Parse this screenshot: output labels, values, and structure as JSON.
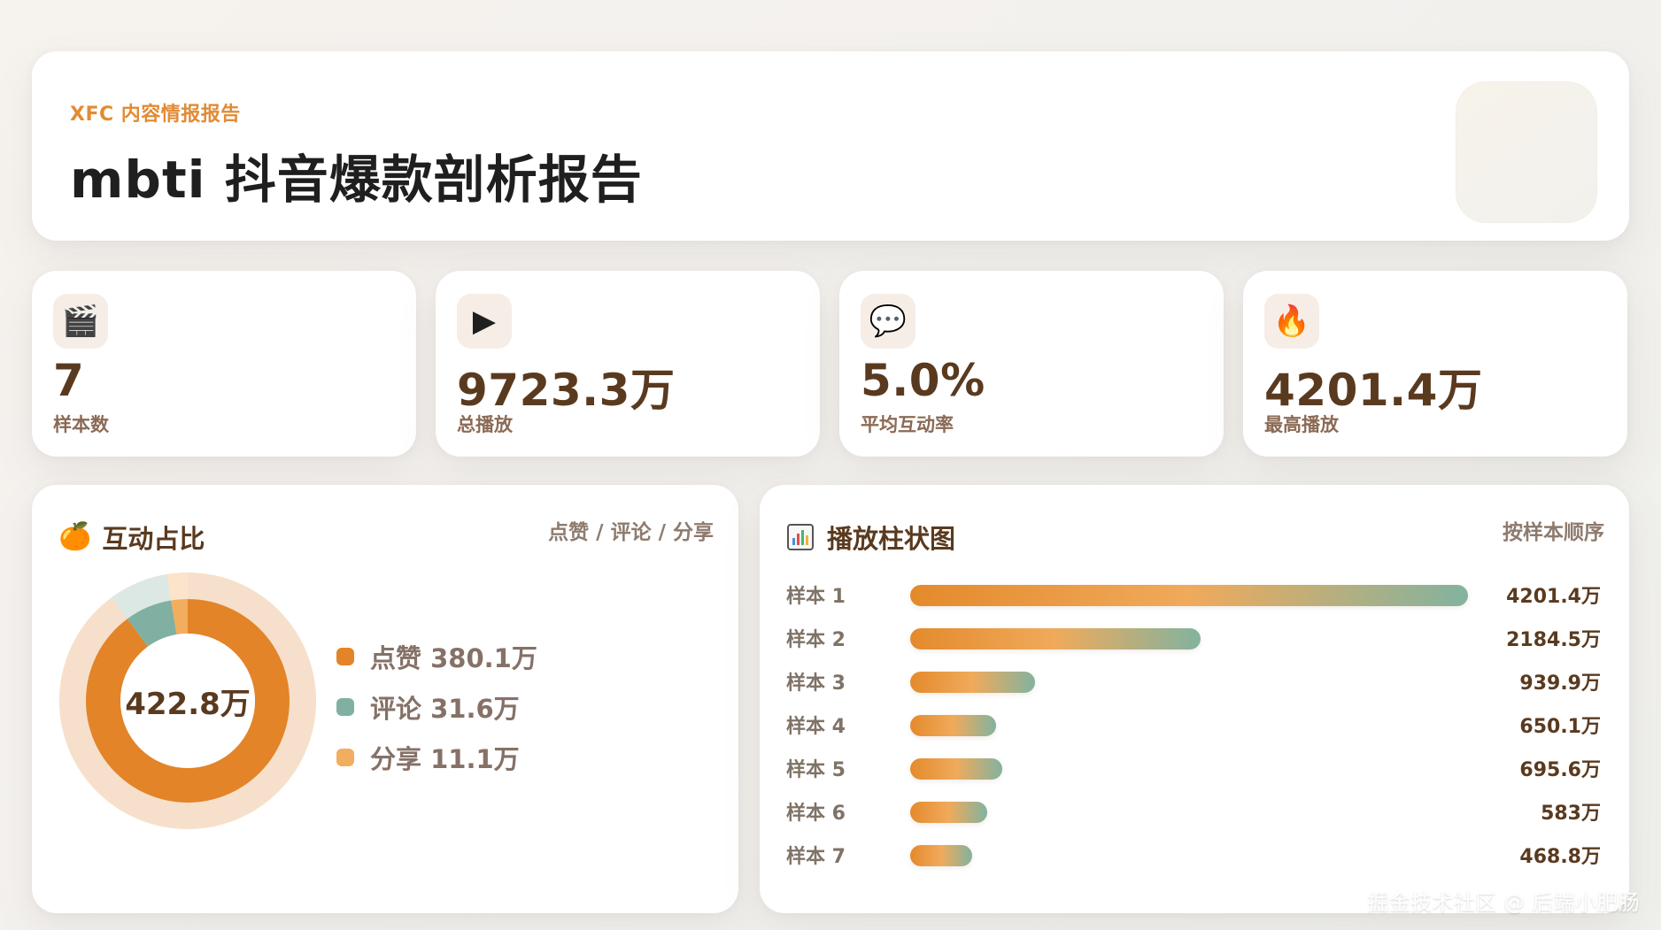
{
  "header": {
    "eyebrow": "XFC 内容情报报告",
    "title": "mbti 抖音爆款剖析报告"
  },
  "stats": [
    {
      "icon": "clapperboard-icon",
      "icon_glyph": "🎬",
      "value": "7",
      "label": "样本数"
    },
    {
      "icon": "play-icon",
      "icon_glyph": "▶",
      "value": "9723.3万",
      "label": "总播放"
    },
    {
      "icon": "chat-icon",
      "icon_glyph": "💬",
      "value": "5.0%",
      "label": "平均互动率"
    },
    {
      "icon": "fire-icon",
      "icon_glyph": "🔥",
      "value": "4201.4万",
      "label": "最高播放"
    }
  ],
  "interaction_panel": {
    "icon": "tangerine-icon",
    "icon_glyph": "🍊",
    "title": "互动占比",
    "subtitle": "点赞 / 评论 / 分享",
    "center_text": "422.8万",
    "legend": [
      {
        "label": "点赞 380.1万",
        "color": "#e38428",
        "value": 380.1
      },
      {
        "label": "评论 31.6万",
        "color": "#80b0a1",
        "value": 31.6
      },
      {
        "label": "分享 11.1万",
        "color": "#f1ae5f",
        "value": 11.1
      }
    ]
  },
  "bar_panel": {
    "icon": "bar-chart-icon",
    "title": "播放柱状图",
    "subtitle": "按样本顺序",
    "rows": [
      {
        "label": "样本 1",
        "value_text": "4201.4万",
        "value": 4201.4
      },
      {
        "label": "样本 2",
        "value_text": "2184.5万",
        "value": 2184.5
      },
      {
        "label": "样本 3",
        "value_text": "939.9万",
        "value": 939.9
      },
      {
        "label": "样本 4",
        "value_text": "650.1万",
        "value": 650.1
      },
      {
        "label": "样本 5",
        "value_text": "695.6万",
        "value": 695.6
      },
      {
        "label": "样本 6",
        "value_text": "583万",
        "value": 583
      },
      {
        "label": "样本 7",
        "value_text": "468.8万",
        "value": 468.8
      }
    ]
  },
  "watermark": "掘金技术社区 @ 后端小肥肠",
  "colors": {
    "accent": "#e28b35",
    "brown": "#5a3a1f",
    "teal": "#80b0a1",
    "background": "#f3f1ee"
  }
}
